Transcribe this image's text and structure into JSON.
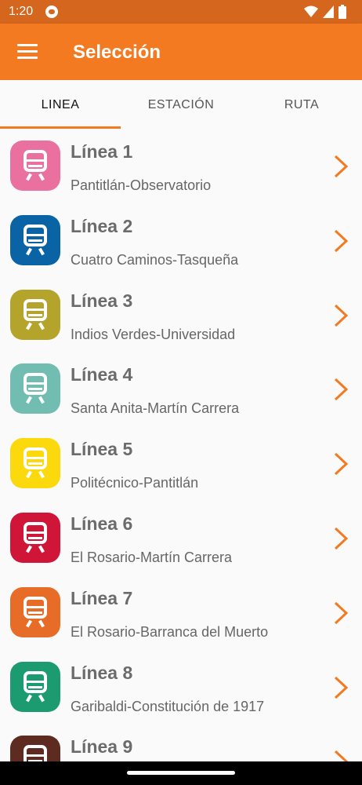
{
  "status_bar": {
    "time": "1:20"
  },
  "app_bar": {
    "title": "Selección",
    "color": "#f47a22"
  },
  "tabs": [
    {
      "label": "LINEA",
      "active": true
    },
    {
      "label": "ESTACIÓN",
      "active": false
    },
    {
      "label": "RUTA",
      "active": false
    }
  ],
  "lines": [
    {
      "name": "Línea 1",
      "route": "Pantitlán-Observatorio",
      "color": "#e9709f"
    },
    {
      "name": "Línea 2",
      "route": "Cuatro Caminos-Tasqueña",
      "color": "#0a63a5"
    },
    {
      "name": "Línea 3",
      "route": "Indios Verdes-Universidad",
      "color": "#b5a42b"
    },
    {
      "name": "Línea 4",
      "route": "Santa Anita-Martín Carrera",
      "color": "#72bdb2"
    },
    {
      "name": "Línea 5",
      "route": "Politécnico-Pantitlán",
      "color": "#fbd90c"
    },
    {
      "name": "Línea 6",
      "route": "El Rosario-Martín Carrera",
      "color": "#cf1538"
    },
    {
      "name": "Línea 7",
      "route": "El Rosario-Barranca del Muerto",
      "color": "#e66c28"
    },
    {
      "name": "Línea 8",
      "route": "Garibaldi-Constitución de 1917",
      "color": "#1b9b6f"
    },
    {
      "name": "Línea 9",
      "route": "",
      "color": "#5e2b21"
    }
  ],
  "icons": {
    "menu": "menu-icon",
    "train": "train-icon",
    "chevron": "chevron-right-icon"
  }
}
